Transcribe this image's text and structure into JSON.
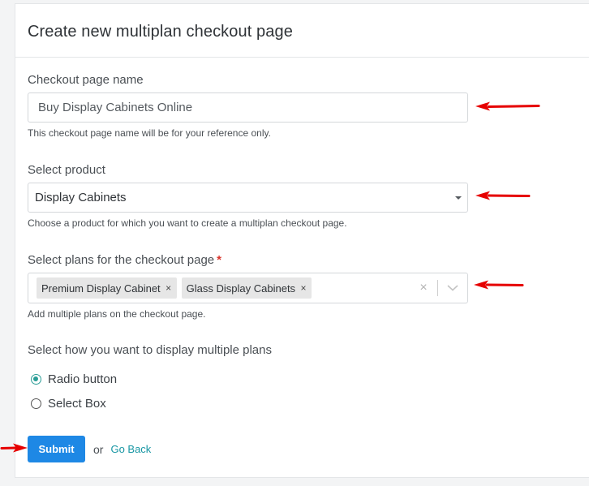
{
  "card": {
    "title": "Create new multiplan checkout page"
  },
  "checkout_name": {
    "label": "Checkout page name",
    "value": "Buy Display Cabinets Online",
    "help": "This checkout page name will be for your reference only."
  },
  "product": {
    "label": "Select product",
    "selected": "Display Cabinets",
    "help": "Choose a product for which you want to create a multiplan checkout page."
  },
  "plans": {
    "label": "Select plans for the checkout page",
    "required_mark": "*",
    "tags": [
      {
        "label": "Premium Display Cabinet",
        "remove": "×"
      },
      {
        "label": "Glass Display Cabinets",
        "remove": "×"
      }
    ],
    "clear_glyph": "×",
    "help": "Add multiple plans on the checkout page."
  },
  "display": {
    "label": "Select how you want to display multiple plans",
    "options": [
      {
        "label": "Radio button",
        "checked": true
      },
      {
        "label": "Select Box",
        "checked": false
      }
    ]
  },
  "actions": {
    "submit_label": "Submit",
    "or_text": "or",
    "go_back_label": "Go Back"
  },
  "colors": {
    "primary": "#1e88e5",
    "link": "#1796a3",
    "radio_checked": "#2a9d96",
    "required": "#d9342b",
    "annotation_arrow": "#e60000"
  }
}
